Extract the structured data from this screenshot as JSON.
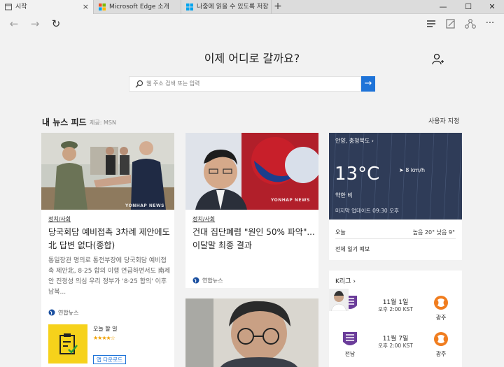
{
  "tabs": [
    {
      "label": "시작",
      "close": "×"
    },
    {
      "label": "Microsoft Edge 소개"
    },
    {
      "label": "나중에 읽을 수 있도록 저장"
    }
  ],
  "newtab": "+",
  "window": {
    "minimize": "—",
    "maximize": "☐",
    "close": "✕"
  },
  "toolbar": {
    "back": "←",
    "forward": "→",
    "refresh": "↻",
    "more": "···"
  },
  "page": {
    "headline": "이제 어디로 갈까요?",
    "search_placeholder": "웹 주소 검색 또는 입력",
    "search_go": "→"
  },
  "feed": {
    "title": "내 뉴스 피드",
    "source": "제공: MSN",
    "customize": "사용자 지정"
  },
  "articles": [
    {
      "category": "정치/사회",
      "title": "당국회담 예비접촉 3차례 제안에도 北 답변 없다(종합)",
      "desc": "통일장관 명의로 통전부장에 당국회담 예비접촉 제안北, 8·25 합의 이행 연급하면서도 南제안 진정성 의심 우리 정부가 '8·25 합의' 이후 남북...",
      "source": "연합뉴스",
      "watermark": "YONHAP NEWS"
    },
    {
      "category": "정치/사회",
      "title": "건대 집단폐렴 \"원인 50% 파악\"...이달말 최종 결과",
      "source": "연합뉴스",
      "watermark": "YONHAP NEWS"
    }
  ],
  "app": {
    "label": "오늘 할 일",
    "stars": "★★★★☆",
    "download": "앱 다운로드"
  },
  "weather": {
    "location": "안양, 충청북도 ›",
    "temp": "13°C",
    "wind": "➤ 8 km/h",
    "condition": "약한 비",
    "updated": "마지막 업데이트 09:30 오후",
    "today_label": "오늘",
    "hi_lo": "높음 20° 낮음 9°",
    "full_forecast": "전체 일기 예보"
  },
  "kleague": {
    "title": "K리그 ›",
    "matches": [
      {
        "date": "11월 1일",
        "time": "오후 2:00 KST",
        "home": "",
        "away": "광주"
      },
      {
        "date": "11월 7일",
        "time": "오후 2:00 KST",
        "home": "전남",
        "away": "광주"
      }
    ]
  }
}
